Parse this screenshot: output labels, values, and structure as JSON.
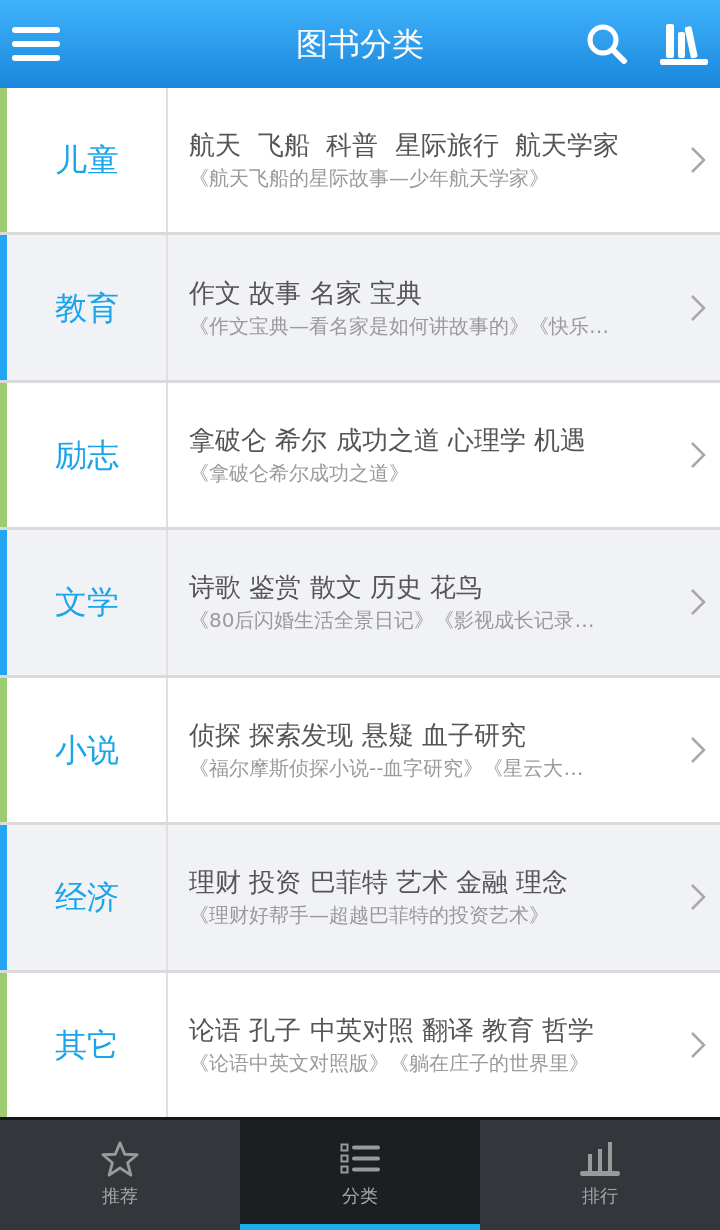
{
  "header": {
    "title": "图书分类"
  },
  "categories": [
    {
      "name": "儿童",
      "color": "#9ccc6f",
      "tags": "航天  飞船  科普  星际旅行  航天学家",
      "books": "《航天飞船的星际故事—少年航天学家》"
    },
    {
      "name": "教育",
      "color": "#22a6f2",
      "tags": "作文 故事 名家 宝典",
      "books": "《作文宝典—看名家是如何讲故事的》《快乐…"
    },
    {
      "name": "励志",
      "color": "#9ccc6f",
      "tags": "拿破仑 希尔 成功之道 心理学 机遇",
      "books": "《拿破仑希尔成功之道》"
    },
    {
      "name": "文学",
      "color": "#22a6f2",
      "tags": "诗歌 鉴赏 散文 历史 花鸟",
      "books": "《80后闪婚生活全景日记》《影视成长记录…"
    },
    {
      "name": "小说",
      "color": "#9ccc6f",
      "tags": "侦探 探索发现 悬疑 血子研究",
      "books": "《福尔摩斯侦探小说--血字研究》《星云大…"
    },
    {
      "name": "经济",
      "color": "#22a6f2",
      "tags": "理财 投资 巴菲特 艺术 金融 理念",
      "books": "《理财好帮手—超越巴菲特的投资艺术》"
    },
    {
      "name": "其它",
      "color": "#9ccc6f",
      "tags": "论语 孔子 中英对照 翻译 教育 哲学",
      "books": "《论语中英文对照版》《躺在庄子的世界里》"
    }
  ],
  "tabs": [
    {
      "label": "推荐",
      "selected": false
    },
    {
      "label": "分类",
      "selected": true
    },
    {
      "label": "排行",
      "selected": false
    }
  ]
}
